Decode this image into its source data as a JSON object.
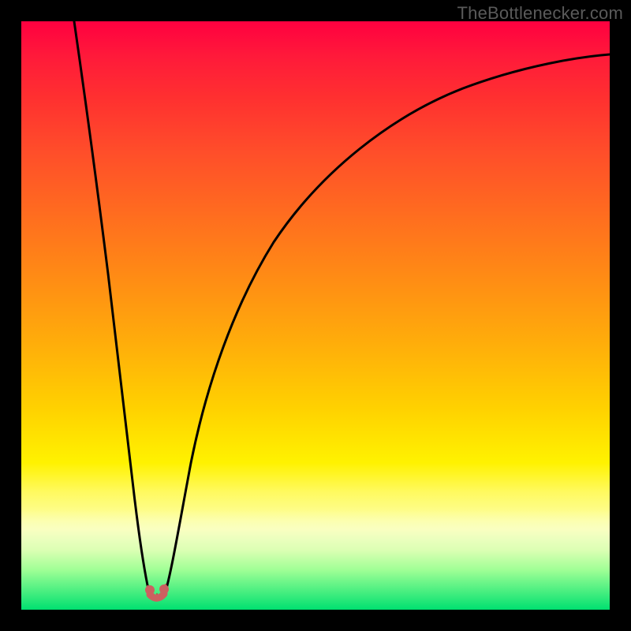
{
  "watermark": "TheBottlenecker.com",
  "chart_data": {
    "type": "line",
    "title": "",
    "xlabel": "",
    "ylabel": "",
    "xlim": [
      0,
      100
    ],
    "ylim": [
      0,
      100
    ],
    "series": [
      {
        "name": "bottleneck-curve",
        "x": [
          0,
          5,
          10,
          14,
          16,
          18,
          19.5,
          21,
          22.5,
          24,
          26,
          30,
          35,
          42,
          50,
          60,
          72,
          85,
          100
        ],
        "y": [
          100,
          80,
          58,
          35,
          20,
          8,
          2,
          1,
          2,
          8,
          22,
          42,
          57,
          68,
          76,
          82,
          87,
          90.5,
          93
        ]
      }
    ],
    "minimum_marker": {
      "x_range": [
        19,
        23
      ],
      "y": 1
    },
    "gradient_stops": [
      {
        "pos": 0,
        "color": "#ff0040"
      },
      {
        "pos": 50,
        "color": "#ffae0a"
      },
      {
        "pos": 75,
        "color": "#fff200"
      },
      {
        "pos": 100,
        "color": "#00e070"
      }
    ]
  }
}
